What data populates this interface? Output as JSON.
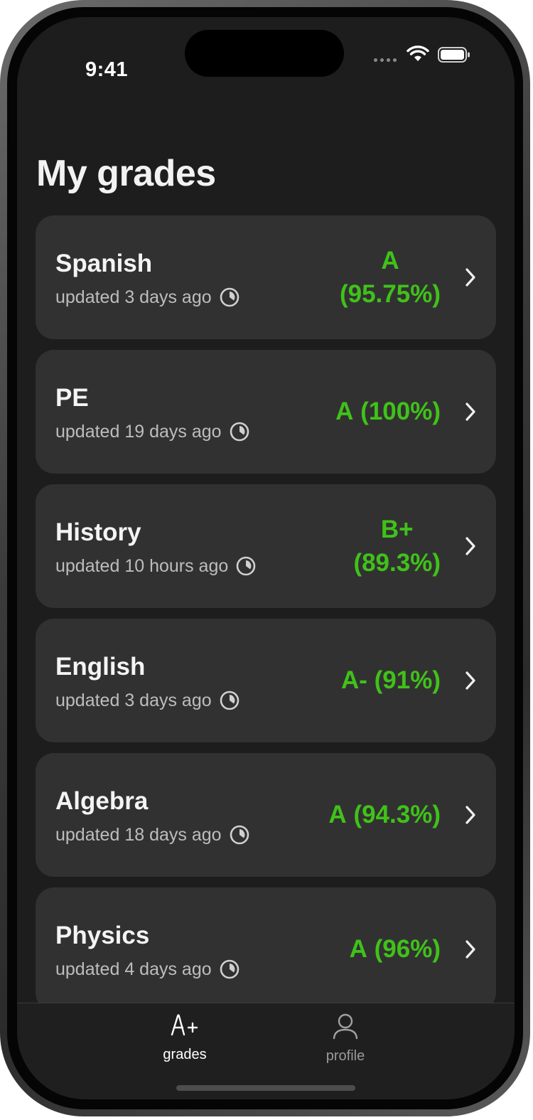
{
  "status_bar": {
    "time": "9:41"
  },
  "page": {
    "title": "My grades"
  },
  "grades": [
    {
      "subject": "Spanish",
      "updated": "updated 3 days ago",
      "grade_letter": "A",
      "grade_percent": "(95.75%)"
    },
    {
      "subject": "PE",
      "updated": "updated 19 days ago",
      "grade_letter": "A",
      "grade_percent": "(100%)"
    },
    {
      "subject": "History",
      "updated": "updated 10 hours ago",
      "grade_letter": "B+",
      "grade_percent": "(89.3%)"
    },
    {
      "subject": "English",
      "updated": "updated 3 days ago",
      "grade_letter": "A-",
      "grade_percent": "(91%)"
    },
    {
      "subject": "Algebra",
      "updated": "updated 18 days ago",
      "grade_letter": "A",
      "grade_percent": "(94.3%)"
    },
    {
      "subject": "Physics",
      "updated": "updated 4 days ago",
      "grade_letter": "A",
      "grade_percent": "(96%)"
    }
  ],
  "tabbar": {
    "grades_label": "grades",
    "grades_icon_text": "A+",
    "profile_label": "profile"
  },
  "colors": {
    "grade": "#3fc21a",
    "card": "#323131",
    "background": "#1d1d1d"
  }
}
